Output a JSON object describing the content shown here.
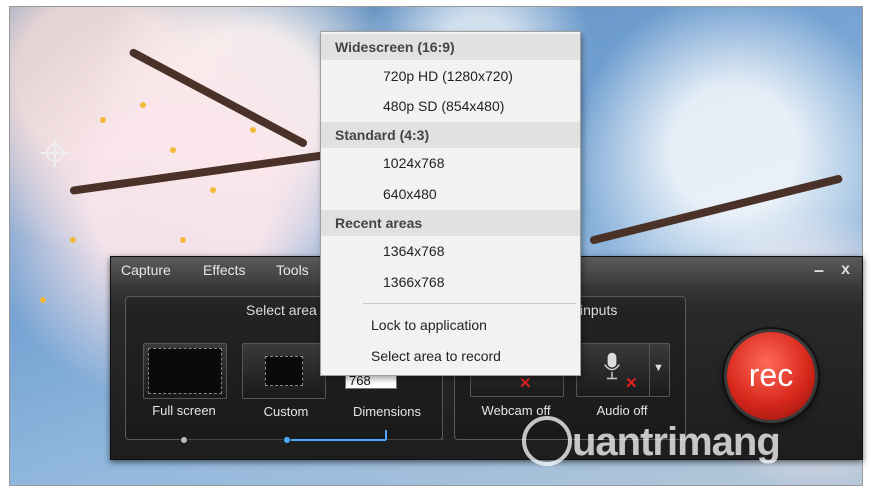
{
  "menubar": {
    "items": [
      "Capture",
      "Effects",
      "Tools"
    ],
    "minimize": "–",
    "close": "x"
  },
  "select_area": {
    "title": "Select area",
    "full_screen": "Full screen",
    "custom": "Custom",
    "dimensions": "Dimensions",
    "dimension_value": "768"
  },
  "inputs": {
    "title": "inputs",
    "webcam": "Webcam off",
    "audio": "Audio off"
  },
  "rec_label": "rec",
  "dropdown": {
    "sections": [
      {
        "header": "Widescreen (16:9)",
        "options": [
          "720p HD (1280x720)",
          "480p SD (854x480)"
        ]
      },
      {
        "header": "Standard (4:3)",
        "options": [
          "1024x768",
          "640x480"
        ]
      },
      {
        "header": "Recent areas",
        "options": [
          "1364x768",
          "1366x768"
        ]
      }
    ],
    "lock": "Lock to application",
    "select_record": "Select area to record"
  },
  "watermark": "uantrimang",
  "colors": {
    "rec_red": "#d8281c",
    "slider_blue": "#4aa8ff",
    "toolbar_dark": "#1d1d1d"
  }
}
